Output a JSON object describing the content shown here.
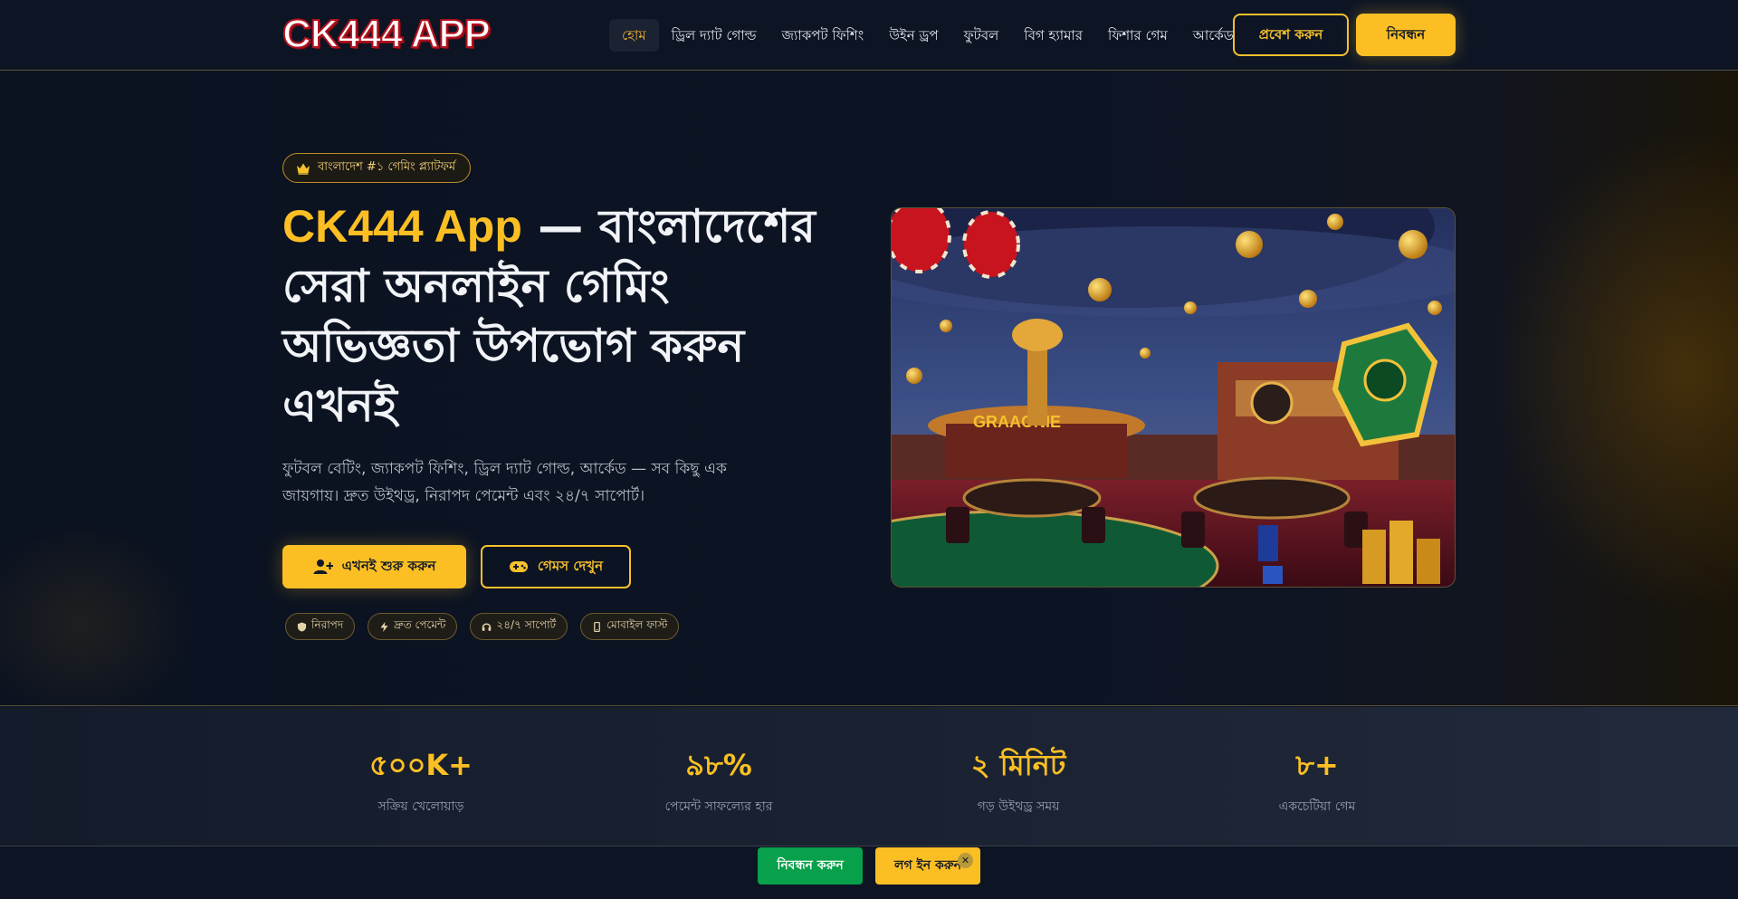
{
  "header": {
    "logo_text": "CK444 APP",
    "nav": [
      {
        "label": "হোম",
        "active": true
      },
      {
        "label": "ড্রিল দ্যাট গোল্ড"
      },
      {
        "label": "জ্যাকপট ফিশিং"
      },
      {
        "label": "উইন ড্রপ"
      },
      {
        "label": "ফুটবল"
      },
      {
        "label": "বিগ হ্যামার"
      },
      {
        "label": "ফিশার গেম"
      },
      {
        "label": "আর্কেড"
      }
    ],
    "login_label": "প্রবেশ করুন",
    "register_label": "নিবন্ধন"
  },
  "hero": {
    "badge": "বাংলাদেশ #১ গেমিং প্ল্যাটফর্ম",
    "title_accent": "CK444 App",
    "title_rest": " — বাংলাদেশের সেরা অনলাইন গেমিং অভিজ্ঞতা উপভোগ করুন এখনই",
    "description": "ফুটবল বেটিং, জ্যাকপট ফিশিং, ড্রিল দ্যাট গোল্ড, আর্কেড — সব কিছু এক জায়গায়। দ্রুত উইথড্র, নিরাপদ পেমেন্ট এবং ২৪/৭ সাপোর্ট।",
    "start_label": "এখনই শুরু করুন",
    "games_label": "গেমস দেখুন",
    "chips": [
      "নিরাপদ",
      "দ্রুত পেমেন্ট",
      "২৪/৭ সাপোর্ট",
      "মোবাইল ফাস্ট"
    ],
    "image_sign": "GRAAONIE"
  },
  "stats": [
    {
      "value": "৫০০K+",
      "label": "সক্রিয় খেলোয়াড়"
    },
    {
      "value": "৯৮%",
      "label": "পেমেন্ট সাফল্যের হার"
    },
    {
      "value": "২ মিনিট",
      "label": "গড় উইথড্র সময়"
    },
    {
      "value": "৮+",
      "label": "একচেটিয়া গেম"
    }
  ],
  "bottom_bar": {
    "register_label": "নিবন্ধন করুন",
    "login_label": "লগ ইন করুন",
    "close_glyph": "✕"
  },
  "colors": {
    "accent": "#fbbf24",
    "background": "#0b1220",
    "green": "#08a04a"
  }
}
